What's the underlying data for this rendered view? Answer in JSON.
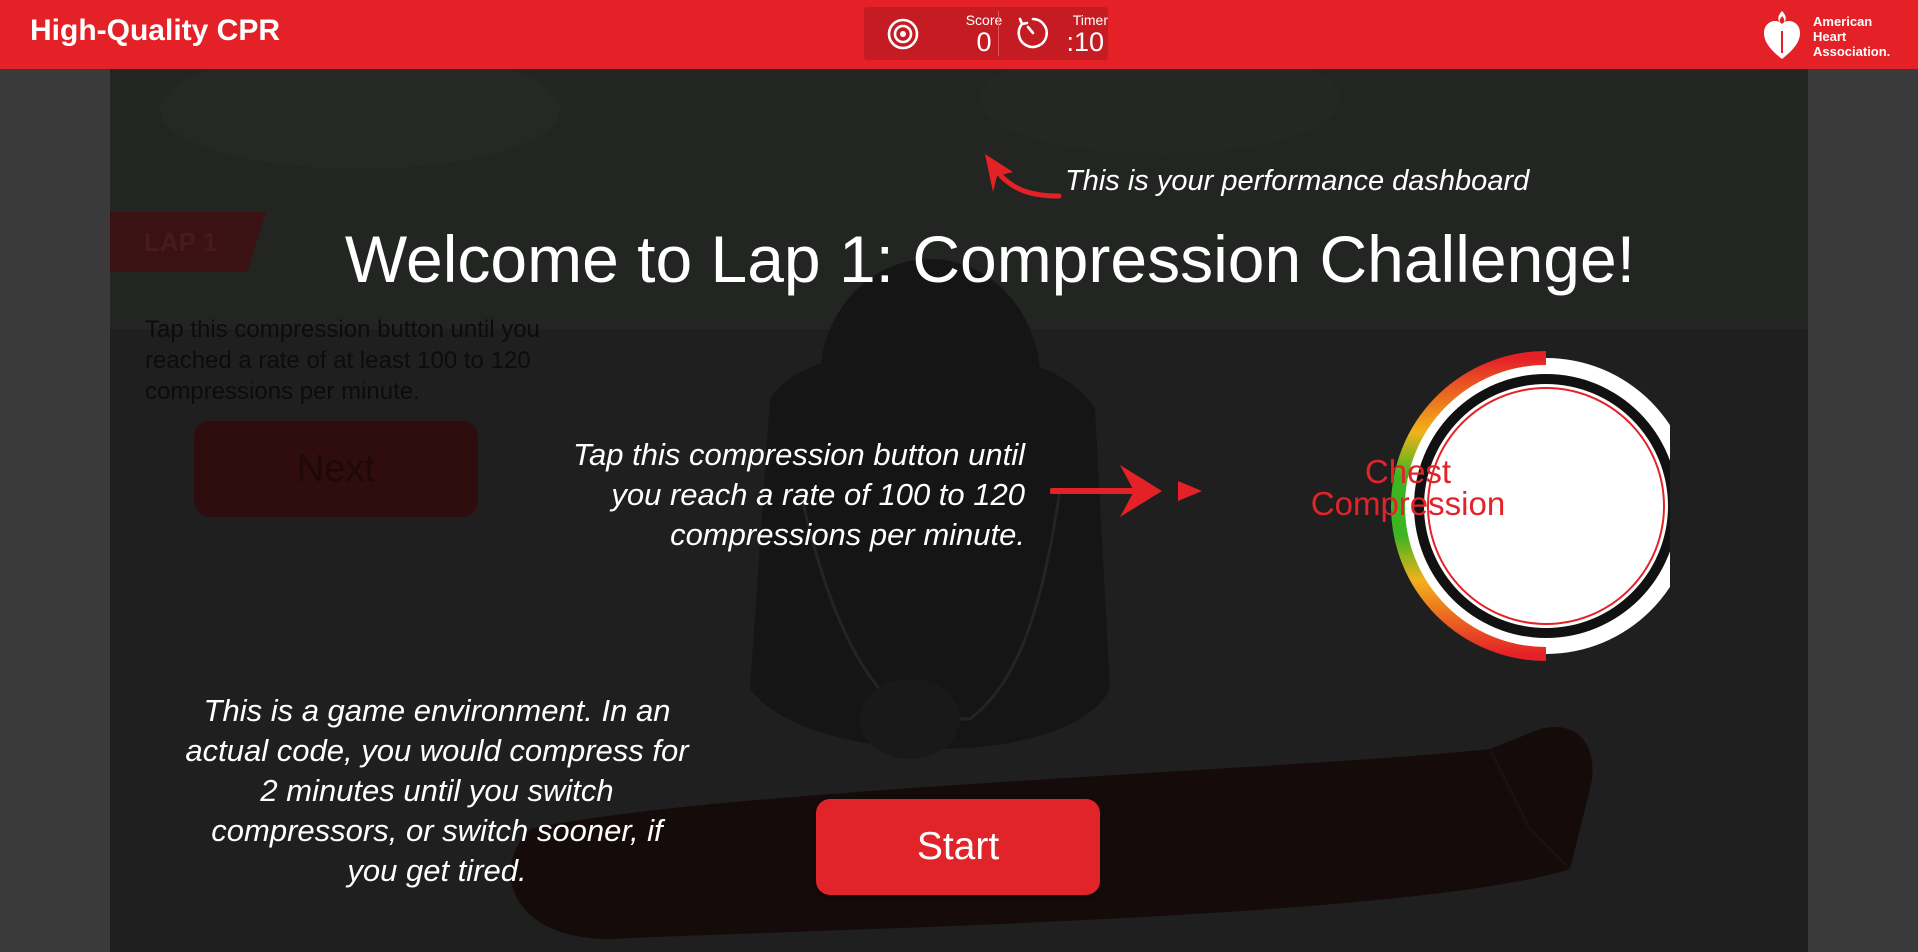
{
  "app": {
    "title": "High-Quality CPR"
  },
  "dashboard": {
    "score_label": "Score",
    "score_value": "0",
    "timer_label": "Timer",
    "timer_value": ":10"
  },
  "logo": {
    "line1": "American",
    "line2": "Heart",
    "line3": "Association."
  },
  "lap_panel": {
    "tab_label": "LAP 1",
    "description": "Tap this compression button until you reached a rate of at least 100 to 120 compressions per minute.",
    "next_label": "Next"
  },
  "overlay": {
    "dashboard_hint": "This is your performance dashboard",
    "welcome_title": "Welcome to Lap 1: Compression Challenge!",
    "tap_hint_lines": [
      "Tap this compression button until",
      "you reach a rate of 100 to 120",
      "compressions per minute."
    ],
    "environment_note_lines": [
      "This is a game environment. In an",
      "actual code, you would compress for",
      "2 minutes until you switch",
      "compressors, or switch sooner, if",
      "you get tired."
    ],
    "start_label": "Start"
  },
  "compression_button": {
    "line1": "Chest",
    "line2": "Compression"
  },
  "colors": {
    "brand_red": "#e42127",
    "stage_bg": "#1d1d1d",
    "meter_green": "#3cb521",
    "meter_yellow": "#e4d21a",
    "meter_red": "#e42127"
  },
  "icons": {
    "score": "target-icon",
    "timer": "stopwatch-icon",
    "logo": "heart-torch-logo"
  }
}
